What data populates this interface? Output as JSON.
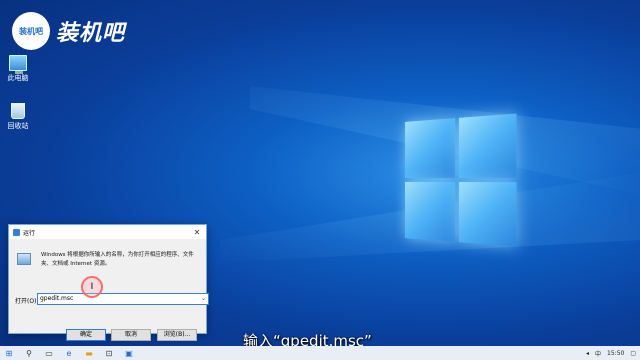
{
  "brand": {
    "badge_text": "装机吧",
    "name": "装机吧"
  },
  "desktop_icons": [
    {
      "label": "此电脑",
      "icon": "computer-icon"
    },
    {
      "label": "回收站",
      "icon": "recycle-bin-icon"
    }
  ],
  "run_dialog": {
    "title": "运行",
    "close_glyph": "✕",
    "description": "Windows 将根据你所输入的名称，为你打开相应的程序、文件夹、文档或 Internet 资源。",
    "open_label": "打开(O):",
    "input_value": "gpedit.msc",
    "buttons": {
      "ok": "确定",
      "cancel": "取消",
      "browse": "浏览(B)..."
    }
  },
  "subtitle": "输入“gpedit.msc”",
  "taskbar": {
    "icons": [
      "windows-start-icon",
      "search-icon",
      "task-view-icon",
      "edge-icon",
      "explorer-icon",
      "store-icon",
      "run-icon"
    ],
    "tray_text": "中",
    "time": "15:50"
  }
}
